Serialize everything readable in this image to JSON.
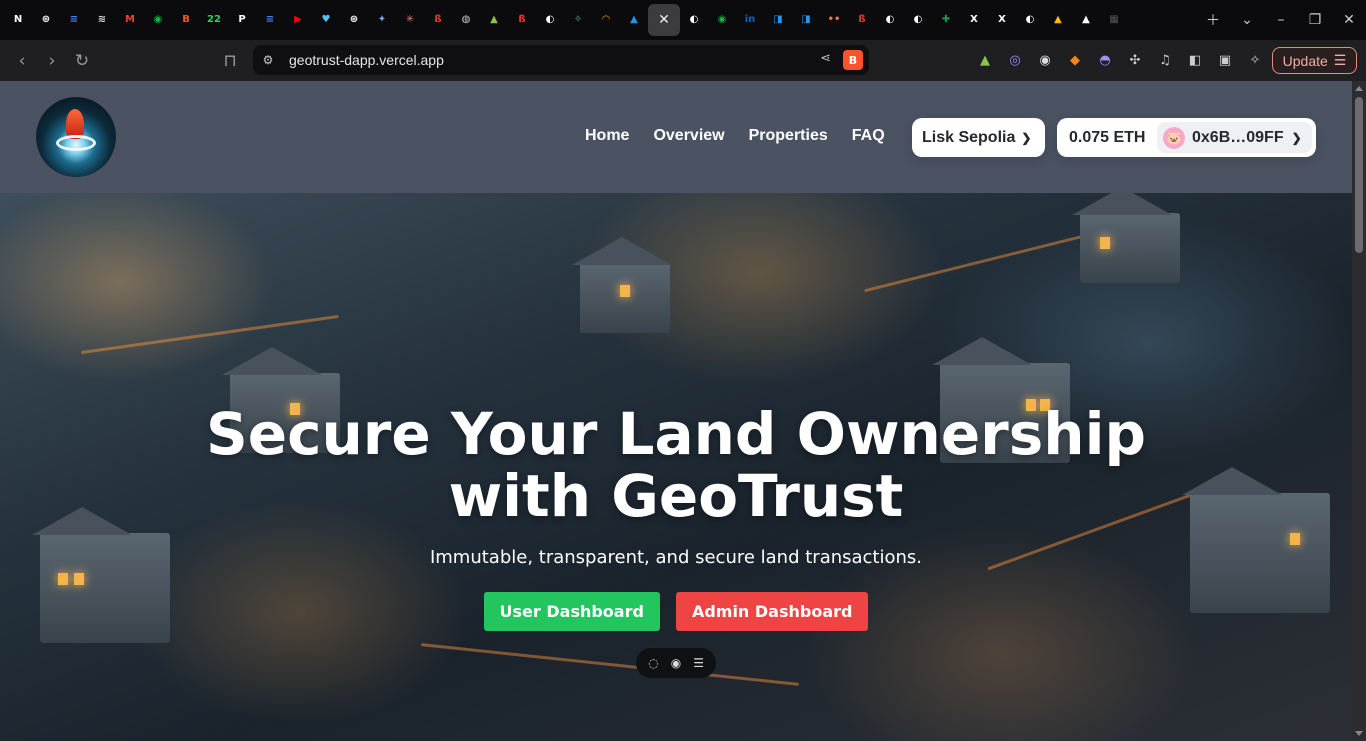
{
  "browser": {
    "tabs": [
      {
        "icon": "notion-icon",
        "glyph": "N",
        "color": "#ffffff"
      },
      {
        "icon": "openai-icon",
        "glyph": "⊛",
        "color": "#ffffff"
      },
      {
        "icon": "google-docs-icon",
        "glyph": "≡",
        "color": "#4285f4"
      },
      {
        "icon": "layers-icon",
        "glyph": "≋",
        "color": "#dddddd"
      },
      {
        "icon": "gmail-icon",
        "glyph": "M",
        "color": "#ea4335"
      },
      {
        "icon": "wechat-icon",
        "glyph": "◉",
        "color": "#09b83e"
      },
      {
        "icon": "brave-icon",
        "glyph": "B",
        "color": "#fb542b"
      },
      {
        "icon": "whatsapp-icon",
        "glyph": "22",
        "color": "#25d366"
      },
      {
        "icon": "perplexity-icon",
        "glyph": "P",
        "color": "#ffffff"
      },
      {
        "icon": "google-docs-icon",
        "glyph": "≡",
        "color": "#4285f4"
      },
      {
        "icon": "youtube-icon",
        "glyph": "▶",
        "color": "#ff0000"
      },
      {
        "icon": "app-icon",
        "glyph": "♥",
        "color": "#4fc3f7"
      },
      {
        "icon": "openai-icon",
        "glyph": "⊛",
        "color": "#ffffff"
      },
      {
        "icon": "gemini-icon",
        "glyph": "✦",
        "color": "#6ea8ff"
      },
      {
        "icon": "claude-icon",
        "glyph": "✳",
        "color": "#e07a5f"
      },
      {
        "icon": "brand-icon",
        "glyph": "ß",
        "color": "#e53935"
      },
      {
        "icon": "globe-icon",
        "glyph": "◍",
        "color": "#cccccc"
      },
      {
        "icon": "chart-icon",
        "glyph": "▲",
        "color": "#8bc34a"
      },
      {
        "icon": "brand-icon",
        "glyph": "ß",
        "color": "#e53935"
      },
      {
        "icon": "github-icon",
        "glyph": "◐",
        "color": "#ffffff"
      },
      {
        "icon": "person-icon",
        "glyph": "✧",
        "color": "#4db6ac"
      },
      {
        "icon": "rainbow-icon",
        "glyph": "◠",
        "color": "#ff9800"
      },
      {
        "icon": "app-icon",
        "glyph": "▲",
        "color": "#2196f3"
      },
      {
        "icon": "close-icon",
        "glyph": "✕",
        "color": "#eeeeee",
        "active": true
      },
      {
        "icon": "github-icon",
        "glyph": "◐",
        "color": "#ffffff"
      },
      {
        "icon": "wechat-icon",
        "glyph": "◉",
        "color": "#09b83e"
      },
      {
        "icon": "linkedin-icon",
        "glyph": "in",
        "color": "#0a66c2"
      },
      {
        "icon": "bookmark-icon",
        "glyph": "◨",
        "color": "#2196f3"
      },
      {
        "icon": "bookmark-icon",
        "glyph": "◨",
        "color": "#2196f3"
      },
      {
        "icon": "dots-icon",
        "glyph": "••",
        "color": "#ff7043"
      },
      {
        "icon": "brand-icon",
        "glyph": "ß",
        "color": "#e53935"
      },
      {
        "icon": "github-icon",
        "glyph": "◐",
        "color": "#ffffff"
      },
      {
        "icon": "github-icon",
        "glyph": "◐",
        "color": "#ffffff"
      },
      {
        "icon": "sheets-icon",
        "glyph": "✚",
        "color": "#0f9d58"
      },
      {
        "icon": "x-icon",
        "glyph": "X",
        "color": "#ffffff"
      },
      {
        "icon": "x-icon",
        "glyph": "X",
        "color": "#ffffff"
      },
      {
        "icon": "github-icon",
        "glyph": "◐",
        "color": "#ffffff"
      },
      {
        "icon": "drive-icon",
        "glyph": "▲",
        "color": "#fbbc04"
      },
      {
        "icon": "app-icon",
        "glyph": "▲",
        "color": "#ffffff"
      },
      {
        "icon": "app-icon",
        "glyph": "▦",
        "color": "#555555"
      }
    ],
    "url": "geotrust-dapp.vercel.app",
    "update_label": "Update",
    "extensions": [
      {
        "icon": "chart-icon",
        "glyph": "▲",
        "color": "#8bc34a"
      },
      {
        "icon": "extension-icon",
        "glyph": "◎",
        "color": "#a78bfa"
      },
      {
        "icon": "target-icon",
        "glyph": "◉",
        "color": "#dddddd"
      },
      {
        "icon": "metamask-icon",
        "glyph": "◆",
        "color": "#f6851b"
      },
      {
        "icon": "ghost-icon",
        "glyph": "◓",
        "color": "#a78bfa"
      },
      {
        "icon": "puzzle-icon",
        "glyph": "✣",
        "color": "#cccccc"
      },
      {
        "icon": "music-icon",
        "glyph": "♫",
        "color": "#cccccc"
      },
      {
        "icon": "sidebar-icon",
        "glyph": "◧",
        "color": "#cccccc"
      },
      {
        "icon": "wallet-icon",
        "glyph": "▣",
        "color": "#cccccc"
      },
      {
        "icon": "ai-icon",
        "glyph": "✧",
        "color": "#cccccc"
      }
    ]
  },
  "site": {
    "nav": [
      "Home",
      "Overview",
      "Properties",
      "FAQ"
    ],
    "network": "Lisk Sepolia",
    "balance": "0.075 ETH",
    "address": "0x6B…09FF",
    "hero": {
      "title": "Secure Your Land Ownership with GeoTrust",
      "subtitle": "Immutable, transparent, and secure land transactions.",
      "user_button": "User Dashboard",
      "admin_button": "Admin Dashboard"
    },
    "colors": {
      "header_bg": "#4b5262",
      "user_button": "#22c55e",
      "admin_button": "#ef4444"
    }
  }
}
